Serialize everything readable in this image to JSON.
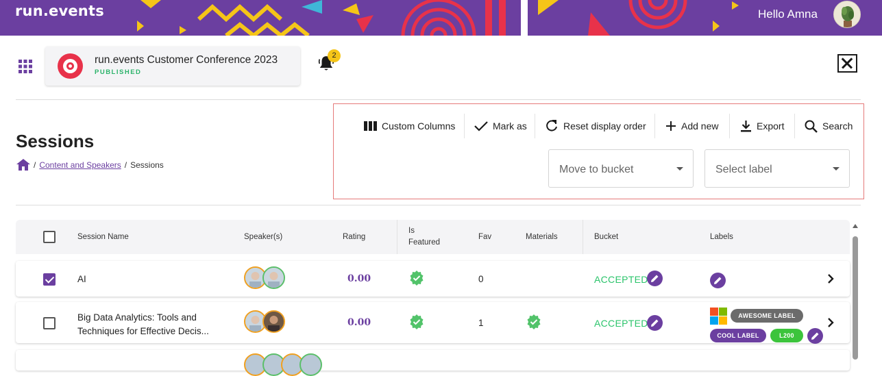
{
  "banner": {
    "logo": "run.events",
    "greeting": "Hello Amna"
  },
  "event": {
    "title": "run.events Customer Conference 2023",
    "status": "PUBLISHED"
  },
  "notifications": {
    "count": "2"
  },
  "page": {
    "title": "Sessions",
    "breadcrumb": {
      "link": "Content and Speakers",
      "separator": "/",
      "current": "Sessions"
    }
  },
  "toolbar": {
    "custom_columns": "Custom Columns",
    "mark_as": "Mark as",
    "reset_order": "Reset display order",
    "add_new": "Add new",
    "export": "Export",
    "search": "Search",
    "bucket_placeholder": "Move to bucket",
    "label_placeholder": "Select label"
  },
  "table": {
    "headers": {
      "session_name": "Session Name",
      "speakers": "Speaker(s)",
      "rating": "Rating",
      "is_featured_1": "Is",
      "is_featured_2": "Featured",
      "fav": "Fav",
      "materials": "Materials",
      "bucket": "Bucket",
      "labels": "Labels"
    },
    "rows": [
      {
        "checked": true,
        "name": "AI",
        "rating": "0.00",
        "is_featured": true,
        "fav": "0",
        "materials": false,
        "bucket": "ACCEPTED",
        "labels": []
      },
      {
        "checked": false,
        "name_line1": "Big Data Analytics: Tools and",
        "name_line2": "Techniques for Effective Decis...",
        "rating": "0.00",
        "is_featured": true,
        "fav": "1",
        "materials": true,
        "bucket": "ACCEPTED",
        "labels": [
          "AWESOME LABEL",
          "COOL LABEL",
          "L200"
        ]
      }
    ]
  },
  "colors": {
    "brand_purple": "#6b3fa0",
    "accepted_green": "#2bc46b",
    "label_gray": "#6b6b6b",
    "label_green": "#3cc43c"
  }
}
